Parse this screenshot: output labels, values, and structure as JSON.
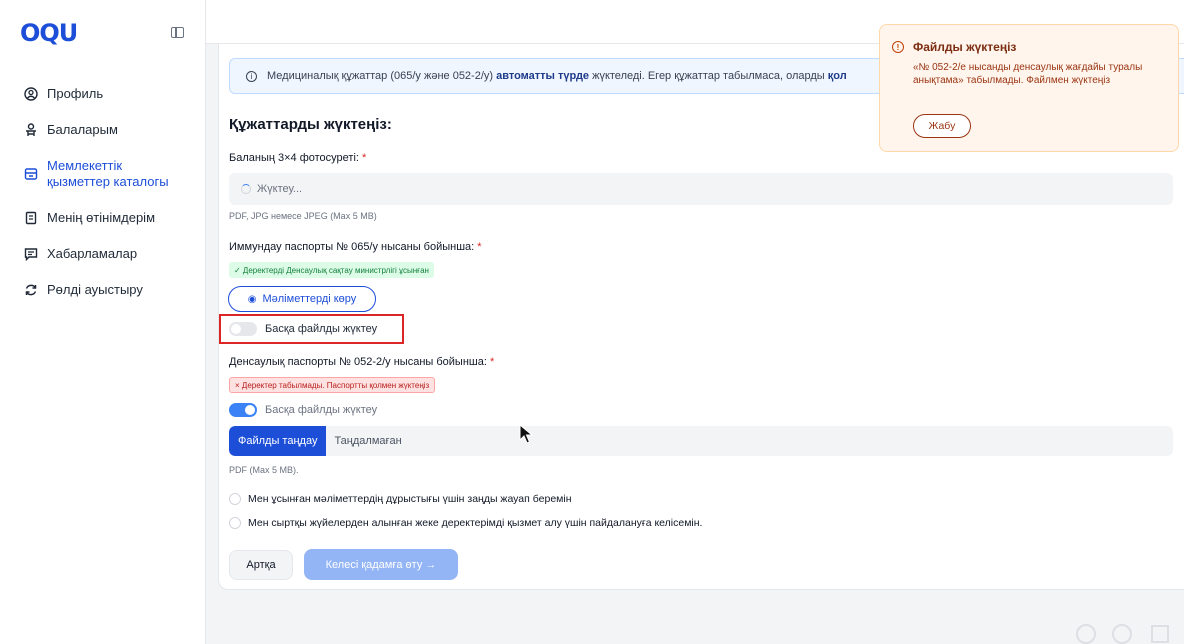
{
  "app": {
    "logo_text": "OQU"
  },
  "sidebar": {
    "items": [
      {
        "label": "Профиль",
        "icon": "user-circle-icon"
      },
      {
        "label": "Балаларым",
        "icon": "children-icon"
      },
      {
        "label": "Мемлекеттік қызметтер каталогы",
        "icon": "catalog-icon"
      },
      {
        "label": "Менің өтінімдерім",
        "icon": "clipboard-icon"
      },
      {
        "label": "Хабарламалар",
        "icon": "message-icon"
      },
      {
        "label": "Рөлді ауыстыру",
        "icon": "refresh-icon"
      }
    ]
  },
  "banner": {
    "text_pre": "Медициналық құжаттар (065/у және 052-2/у) ",
    "text_bold": "автоматты түрде",
    "text_post": " жүктеледі. Егер құжаттар табылмаса, оларды ",
    "text_bold2": "қол"
  },
  "form": {
    "title": "Құжаттарды жүктеңіз:",
    "photo_label": "Баланың 3×4 фотосуреті:",
    "required_mark": "*",
    "photo_status": "Жүктеу...",
    "photo_hint": "PDF, JPG немесе JPEG (Max 5 MB)",
    "immun_label": "Иммундау паспорты № 065/у нысаны бойынша:",
    "immun_badge": "✓ Деректерді Денсаулық сақтау министрлігі ұсынған",
    "view_button": "Мәліметтерді көру",
    "toggle1_label": "Басқа файлды жүктеу",
    "health_label": "Денсаулық паспорты № 052-2/у нысаны бойынша:",
    "health_badge": "× Деректер табылмады. Паспортты қолмен жүктеңіз",
    "toggle2_label": "Басқа файлды жүктеу",
    "file_button": "Файлды таңдау",
    "file_status": "Таңдалмаған",
    "file_hint": "PDF (Max 5 MB).",
    "consent1": "Мен ұсынған мәліметтердің дұрыстығы үшін заңды жауап беремін",
    "consent2": "Мен сыртқы жүйелерден алынған жеке деректерімді қызмет алу үшін пайдалануға келісемін.",
    "back_button": "Артқа",
    "next_button": "Келесі қадамға өту →"
  },
  "toast": {
    "title": "Файлды жүктеңіз",
    "message": "«№ 052-2/е нысанды денсаулық жағдайы туралы анықтама» табылмады. Файлмен жүктеңіз",
    "close_button": "Жабу"
  }
}
